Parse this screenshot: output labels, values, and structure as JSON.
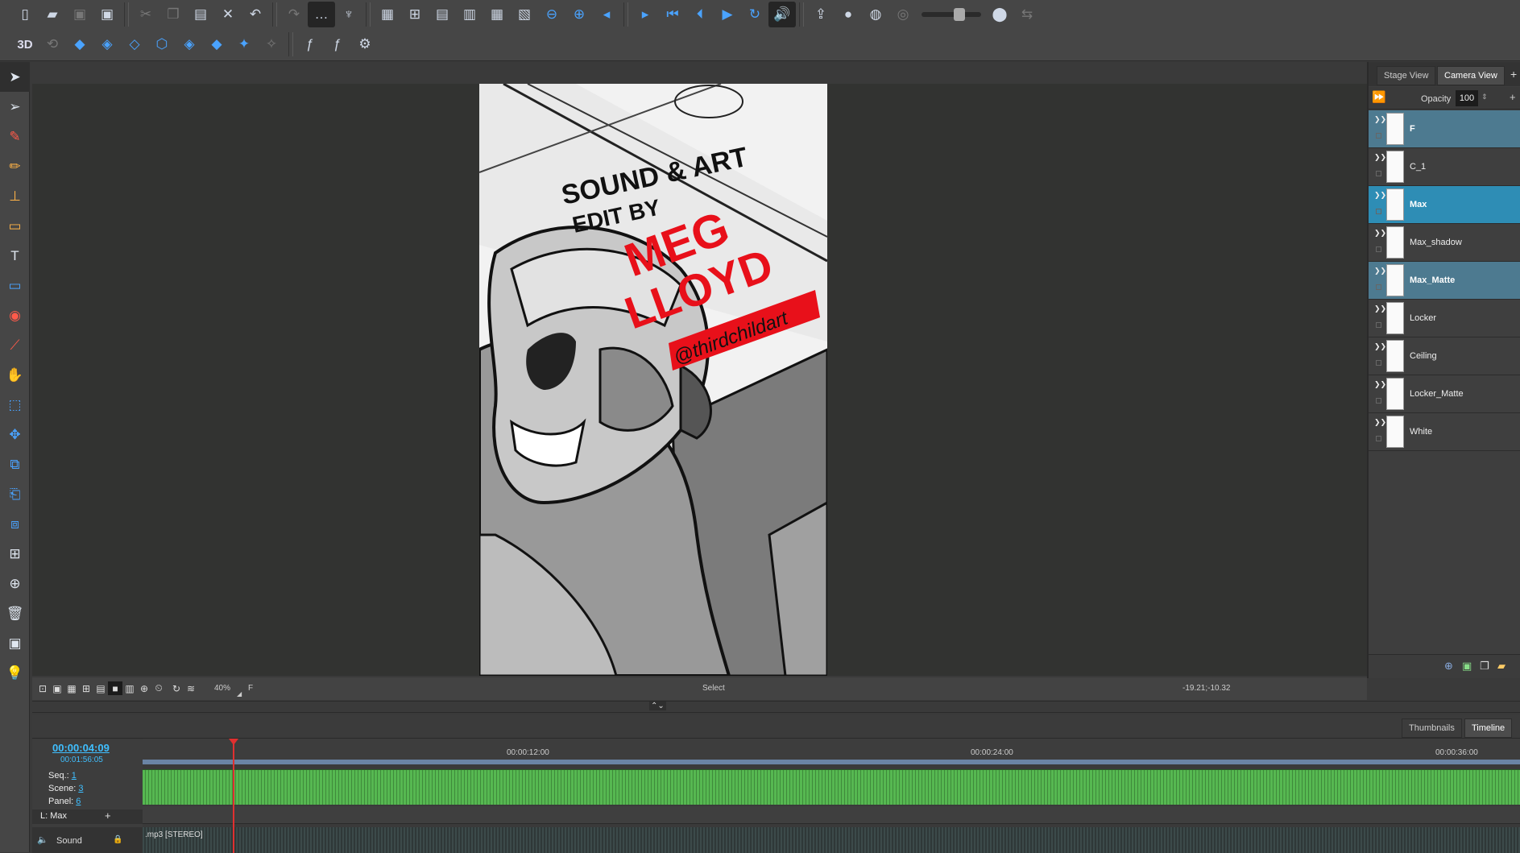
{
  "toolbar": {
    "row1_icons": [
      "new-file-icon",
      "open-folder-icon",
      "save-disabled-icon",
      "save-all-icon",
      "cut-icon",
      "copy-icon",
      "paste-icon",
      "delete-icon",
      "undo-icon",
      "redo-icon",
      "more-icon",
      "tree-icon",
      "grid-icon",
      "grid-2-icon",
      "grid-3-icon",
      "layout-icon",
      "table-icon",
      "crop-icon",
      "zoom-out-icon",
      "zoom-in-icon",
      "prev-panel-icon",
      "next-panel-icon",
      "first-frame-icon",
      "prev-frame-icon",
      "play-icon",
      "loop-icon",
      "volume-icon",
      "share-icon",
      "record-icon",
      "onion-icon",
      "onion-skin-icon",
      "camera-mic-icon",
      "flip-icon"
    ],
    "row2_label_3d": "3D",
    "row2_icons": [
      "3d-rotate-icon",
      "layer-add-icon",
      "layer-copy-icon",
      "layer-merge-icon",
      "layer-flip-icon",
      "layer-select-icon",
      "layer-group-icon",
      "layer-transform-icon",
      "layer-move-icon",
      "function-icon",
      "function-2-icon",
      "settings-icon"
    ]
  },
  "tools": [
    "select-arrow-icon",
    "direct-select-icon",
    "brush-icon",
    "pencil-icon",
    "stamp-icon",
    "eraser-icon",
    "text-icon",
    "rectangle-icon",
    "paint-bucket-icon",
    "dropper-icon",
    "hand-icon",
    "transform-icon",
    "pivot-icon",
    "crop-tool-icon",
    "camera-tool-icon",
    "layer-tool-icon",
    "add-layer-icon",
    "add-panel-icon",
    "trash-icon",
    "clipboard-icon",
    "lightbulb-icon"
  ],
  "stage_bar": {
    "zoom": "40%",
    "layer": "F",
    "mode": "Select",
    "coords": "-19.21;-10.32"
  },
  "right_panel": {
    "tabs": [
      "Stage View",
      "Camera View"
    ],
    "add_tab": "+",
    "opacity_label": "Opacity",
    "opacity_value": "100",
    "layers": [
      {
        "name": "F",
        "bold": true,
        "highlight": "hl"
      },
      {
        "name": "C_1",
        "bold": false,
        "highlight": ""
      },
      {
        "name": "Max",
        "bold": true,
        "highlight": "hl2"
      },
      {
        "name": "Max_shadow",
        "bold": false,
        "highlight": ""
      },
      {
        "name": "Max_Matte",
        "bold": true,
        "highlight": "hl"
      },
      {
        "name": "Locker",
        "bold": false,
        "highlight": ""
      },
      {
        "name": "Ceiling",
        "bold": false,
        "highlight": ""
      },
      {
        "name": "Locker_Matte",
        "bold": false,
        "highlight": ""
      },
      {
        "name": "White",
        "bold": false,
        "highlight": ""
      }
    ]
  },
  "timeline": {
    "tabs": [
      "Thumbnails",
      "Timeline"
    ],
    "current_time": "00:00:04:09",
    "total_time": "00:01:56:05",
    "seq_label": "Seq.:",
    "seq_value": "1",
    "scene_label": "Scene:",
    "scene_value": "3",
    "panel_label": "Panel:",
    "panel_value": "6",
    "layer_label": "L: Max",
    "sound_label": "Sound",
    "sound_file": ".mp3 [STEREO]",
    "ruler": [
      "00:00:12:00",
      "00:00:24:00",
      "00:00:36:00"
    ],
    "playhead_color": "#e03030",
    "track_color": "#56b851"
  },
  "artwork": {
    "line1": "SOUND & ART",
    "line2": "EDIT BY",
    "name1": "MEG",
    "name2": "LLOYD",
    "handle": "@thirdchildart",
    "accent": "#e8101a"
  }
}
